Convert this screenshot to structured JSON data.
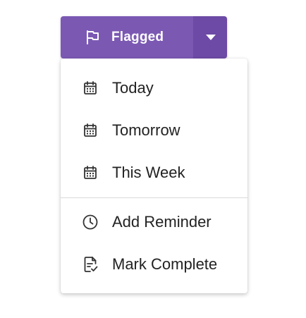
{
  "split_button": {
    "label": "Flagged",
    "main_icon": "flag-icon",
    "toggle_icon": "caret-down-icon",
    "color_main": "#7b59b3",
    "color_toggle": "#6c4aa5"
  },
  "menu": {
    "groups": [
      [
        {
          "label": "Today",
          "icon": "calendar-icon"
        },
        {
          "label": "Tomorrow",
          "icon": "calendar-icon"
        },
        {
          "label": "This Week",
          "icon": "calendar-icon"
        }
      ],
      [
        {
          "label": "Add Reminder",
          "icon": "clock-icon"
        },
        {
          "label": "Mark Complete",
          "icon": "document-check-icon"
        }
      ]
    ]
  }
}
